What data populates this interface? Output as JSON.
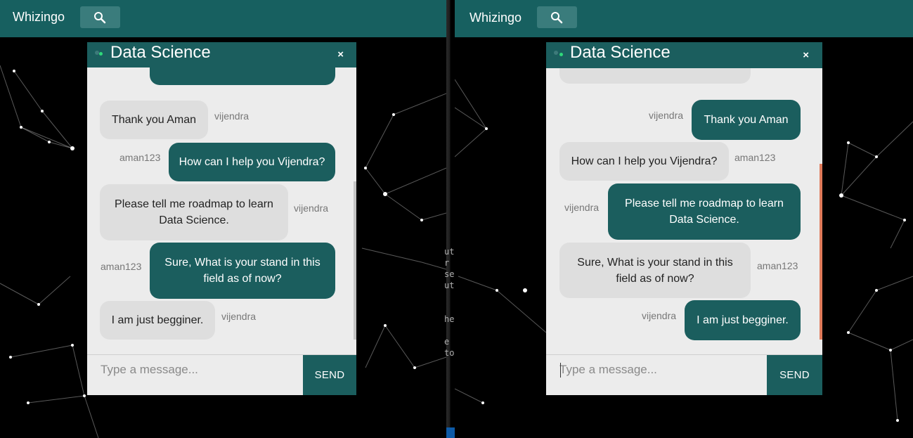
{
  "app": {
    "brand": "Whizingo"
  },
  "colors": {
    "navbar": "#176060",
    "chat_header": "#1b5e5e",
    "bubble_teal": "#1b5e5e",
    "bubble_gray": "#dedede",
    "online": "#2fd97a",
    "scroll_accent": "#e07a5a"
  },
  "left": {
    "chat": {
      "title": "Data Science",
      "close": "×",
      "messages": [
        {
          "sender": "vijendra",
          "text": "Thank you Aman"
        },
        {
          "sender": "aman123",
          "text": "How can I help you Vijendra?"
        },
        {
          "sender": "vijendra",
          "text": "Please tell me roadmap to learn Data Science."
        },
        {
          "sender": "aman123",
          "text": "Sure, What is your stand in this field as of now?"
        },
        {
          "sender": "vijendra",
          "text": "I am just begginer."
        }
      ],
      "input_placeholder": "Type a message...",
      "send_label": "SEND"
    }
  },
  "right": {
    "chat": {
      "title": "Data Science",
      "close": "×",
      "messages": [
        {
          "sender": "vijendra",
          "text": "Thank you Aman"
        },
        {
          "sender": "aman123",
          "text": "How can I help you Vijendra?"
        },
        {
          "sender": "vijendra",
          "text": "Please tell me roadmap to learn Data Science."
        },
        {
          "sender": "aman123",
          "text": "Sure, What is your stand in this field as of now?"
        },
        {
          "sender": "vijendra",
          "text": "I am just begginer."
        }
      ],
      "input_placeholder": "Type a message...",
      "send_label": "SEND"
    }
  },
  "code_fragment": "ut\nr\nse\nut\n\n\nhe\n\ne\nto"
}
